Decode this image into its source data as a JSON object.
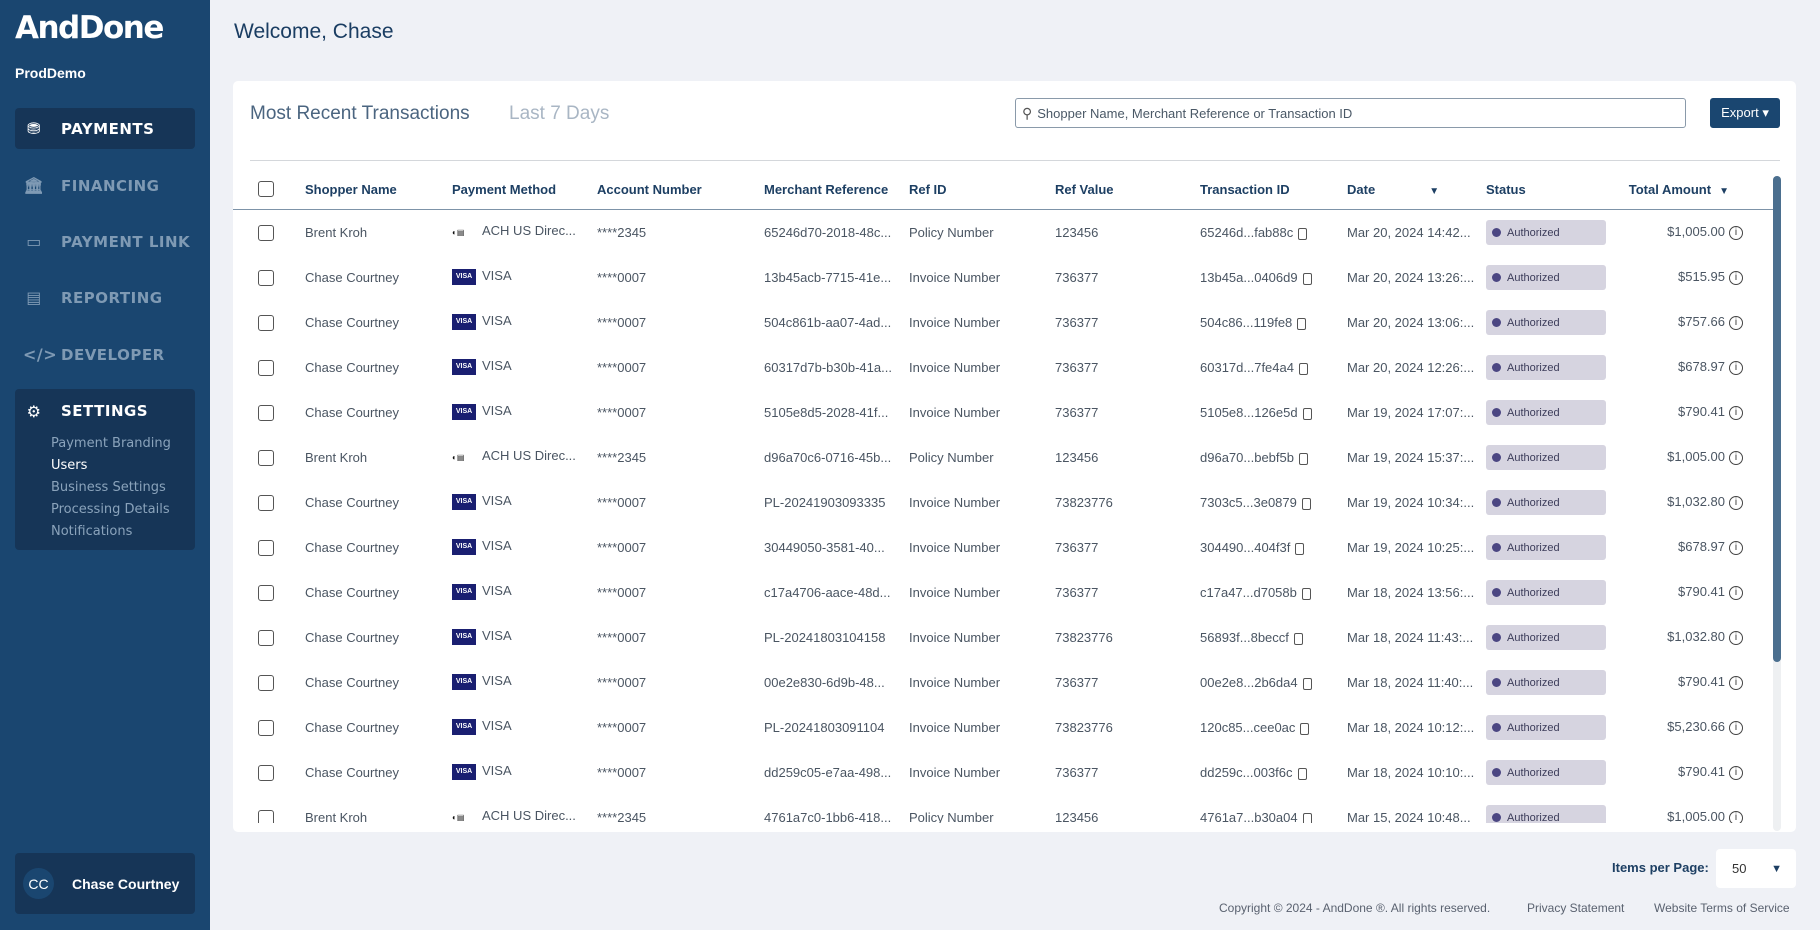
{
  "sidebar": {
    "logo": "AndDone",
    "org": "ProdDemo",
    "items": [
      {
        "label": "PAYMENTS",
        "icon": "payments-icon"
      },
      {
        "label": "FINANCING",
        "icon": "bank-icon"
      },
      {
        "label": "PAYMENT LINK",
        "icon": "link-card-icon"
      },
      {
        "label": "REPORTING",
        "icon": "report-icon"
      },
      {
        "label": "DEVELOPER",
        "icon": "code-icon"
      }
    ],
    "settings": {
      "label": "SETTINGS",
      "icon": "gear-icon",
      "subitems": [
        "Payment Branding",
        "Users",
        "Business Settings",
        "Processing Details",
        "Notifications"
      ],
      "current": "Users"
    },
    "user": {
      "initials": "CC",
      "name": "Chase Courtney"
    }
  },
  "header": {
    "welcome": "Welcome, Chase"
  },
  "card": {
    "title": "Most Recent Transactions",
    "subtitle": "Last 7 Days",
    "search_placeholder": "Shopper Name,  Merchant Reference or Transaction ID",
    "export_label": "Export ▾"
  },
  "table": {
    "columns": [
      "Shopper Name",
      "Payment Method",
      "Account Number",
      "Merchant Reference",
      "Ref ID",
      "Ref Value",
      "Transaction ID",
      "Date",
      "Status",
      "Total Amount"
    ],
    "sort_indicator": "▼",
    "rows": [
      [
        "Brent Kroh",
        "ACH US Direc...",
        "****2345",
        "65246d70-2018-48c...",
        "Policy Number",
        "123456",
        "65246d...fab88c",
        "Mar 20, 2024 14:42...",
        "Authorized",
        "$1,005.00"
      ],
      [
        "Chase Courtney",
        "VISA",
        "****0007",
        "13b45acb-7715-41e...",
        "Invoice Number",
        "736377",
        "13b45a...0406d9",
        "Mar 20, 2024 13:26:...",
        "Authorized",
        "$515.95"
      ],
      [
        "Chase Courtney",
        "VISA",
        "****0007",
        "504c861b-aa07-4ad...",
        "Invoice Number",
        "736377",
        "504c86...119fe8",
        "Mar 20, 2024 13:06:...",
        "Authorized",
        "$757.66"
      ],
      [
        "Chase Courtney",
        "VISA",
        "****0007",
        "60317d7b-b30b-41a...",
        "Invoice Number",
        "736377",
        "60317d...7fe4a4",
        "Mar 20, 2024 12:26:...",
        "Authorized",
        "$678.97"
      ],
      [
        "Chase Courtney",
        "VISA",
        "****0007",
        "5105e8d5-2028-41f...",
        "Invoice Number",
        "736377",
        "5105e8...126e5d",
        "Mar 19, 2024 17:07:...",
        "Authorized",
        "$790.41"
      ],
      [
        "Brent Kroh",
        "ACH US Direc...",
        "****2345",
        "d96a70c6-0716-45b...",
        "Policy Number",
        "123456",
        "d96a70...bebf5b",
        "Mar 19, 2024 15:37:...",
        "Authorized",
        "$1,005.00"
      ],
      [
        "Chase Courtney",
        "VISA",
        "****0007",
        "PL-20241903093335",
        "Invoice Number",
        "73823776",
        "7303c5...3e0879",
        "Mar 19, 2024 10:34:...",
        "Authorized",
        "$1,032.80"
      ],
      [
        "Chase Courtney",
        "VISA",
        "****0007",
        "30449050-3581-40...",
        "Invoice Number",
        "736377",
        "304490...404f3f",
        "Mar 19, 2024 10:25:...",
        "Authorized",
        "$678.97"
      ],
      [
        "Chase Courtney",
        "VISA",
        "****0007",
        "c17a4706-aace-48d...",
        "Invoice Number",
        "736377",
        "c17a47...d7058b",
        "Mar 18, 2024 13:56:...",
        "Authorized",
        "$790.41"
      ],
      [
        "Chase Courtney",
        "VISA",
        "****0007",
        "PL-20241803104158",
        "Invoice Number",
        "73823776",
        "56893f...8beccf",
        "Mar 18, 2024 11:43:...",
        "Authorized",
        "$1,032.80"
      ],
      [
        "Chase Courtney",
        "VISA",
        "****0007",
        "00e2e830-6d9b-48...",
        "Invoice Number",
        "736377",
        "00e2e8...2b6da4",
        "Mar 18, 2024 11:40:...",
        "Authorized",
        "$790.41"
      ],
      [
        "Chase Courtney",
        "VISA",
        "****0007",
        "PL-20241803091104",
        "Invoice Number",
        "73823776",
        "120c85...cee0ac",
        "Mar 18, 2024 10:12:...",
        "Authorized",
        "$5,230.66"
      ],
      [
        "Chase Courtney",
        "VISA",
        "****0007",
        "dd259c05-e7aa-498...",
        "Invoice Number",
        "736377",
        "dd259c...003f6c",
        "Mar 18, 2024 10:10:...",
        "Authorized",
        "$790.41"
      ],
      [
        "Brent Kroh",
        "ACH US Direc...",
        "****2345",
        "4761a7c0-1bb6-418...",
        "Policy Number",
        "123456",
        "4761a7...b30a04",
        "Mar 15, 2024 10:48...",
        "Authorized",
        "$1,005.00"
      ]
    ]
  },
  "pagination": {
    "label": "Items per Page:",
    "value": "50"
  },
  "footer": {
    "copyright": "Copyright © 2024 - AndDone ®. All rights reserved.",
    "privacy": "Privacy Statement",
    "terms": "Website Terms of Service"
  },
  "colors": {
    "sidebar": "#1a4670",
    "active": "#163557",
    "accent": "#1a4670",
    "badge": "#d6d4e0"
  }
}
